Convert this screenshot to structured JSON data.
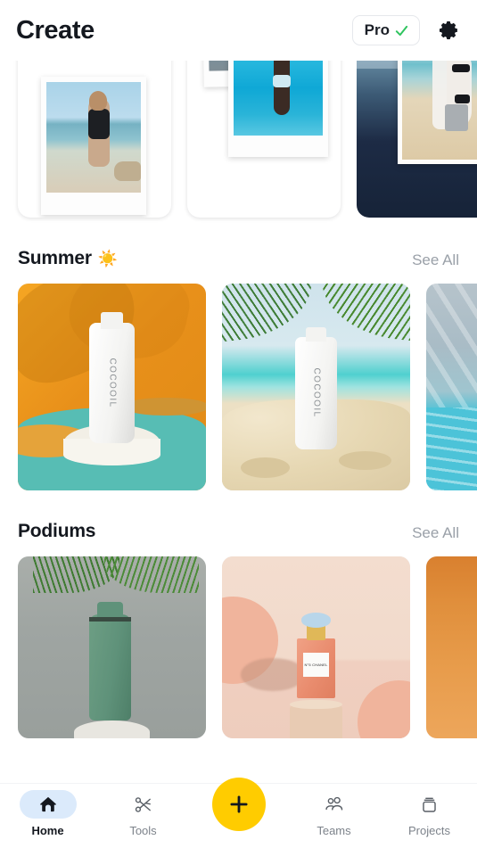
{
  "header": {
    "title": "Create",
    "pro_label": "Pro",
    "pro_check_icon": "check-icon",
    "settings_icon": "gear-icon"
  },
  "featured_row": {
    "name": "featured-templates",
    "cards": [
      {
        "id": "card-1",
        "style": "polaroid-single",
        "description": "Polaroid photo of woman in black swimsuit on beach"
      },
      {
        "id": "card-2",
        "style": "polaroid-stack",
        "description": "Two stacked polaroids, underwater swimmer"
      },
      {
        "id": "card-3",
        "style": "ocean-overlay",
        "description": "Dark ocean sunset with beach photo overlay"
      }
    ]
  },
  "sections": [
    {
      "id": "summer",
      "title": "Summer",
      "emoji": "☀️",
      "emoji_icon": "sun-icon",
      "see_all": "See All",
      "tiles": [
        {
          "id": "summer-1",
          "style": "orange-podium",
          "product_label": "COCOOIL",
          "description": "White bottle on podium, orange palm-shadow backdrop"
        },
        {
          "id": "summer-2",
          "style": "beach-sand",
          "product_label": "COCOOIL",
          "description": "White bottle in sand with palm fronds and sea"
        },
        {
          "id": "summer-3",
          "style": "pool-water",
          "product_label": "",
          "description": "Pool water with light rays and white podium"
        }
      ]
    },
    {
      "id": "podiums",
      "title": "Podiums",
      "emoji": "",
      "emoji_icon": "",
      "see_all": "See All",
      "tiles": [
        {
          "id": "podium-1",
          "style": "green-bottle",
          "product_label": "",
          "description": "Green bottle on concrete backdrop with palm leaves"
        },
        {
          "id": "podium-2",
          "style": "peach-perfume",
          "product_label": "N°5 CHANEL",
          "description": "Perfume bottle on beige podium with peach circles"
        },
        {
          "id": "podium-3",
          "style": "orange-gradient",
          "product_label": "",
          "description": "Orange gradient backdrop"
        }
      ]
    }
  ],
  "bottom_nav": {
    "items": [
      {
        "id": "home",
        "label": "Home",
        "icon": "home-icon",
        "active": true
      },
      {
        "id": "tools",
        "label": "Tools",
        "icon": "scissors-icon",
        "active": false
      },
      {
        "id": "teams",
        "label": "Teams",
        "icon": "people-icon",
        "active": false
      },
      {
        "id": "projects",
        "label": "Projects",
        "icon": "box-icon",
        "active": false
      }
    ],
    "fab": {
      "id": "create",
      "icon": "plus-icon",
      "color": "#FFCC00"
    }
  },
  "colors": {
    "accent_yellow": "#FFCC00",
    "active_pill": "#DBEAFB",
    "text_primary": "#14181F",
    "text_muted": "#9AA0A8",
    "check_green": "#2FC45F"
  }
}
